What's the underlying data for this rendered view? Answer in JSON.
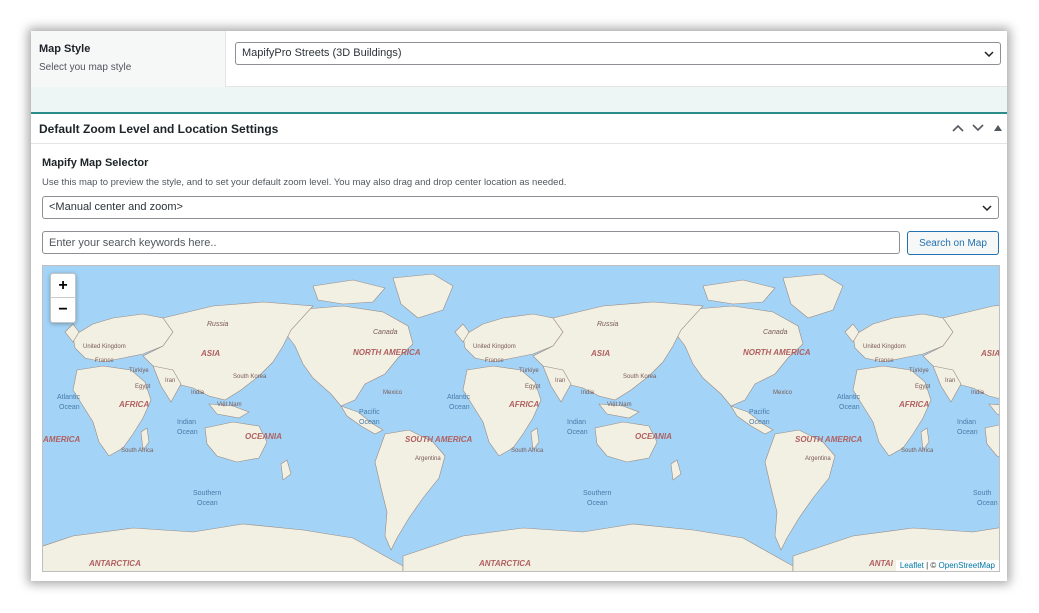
{
  "map_style": {
    "label": "Map Style",
    "description": "Select you map style",
    "selected": "MapifyPro Streets (3D Buildings)"
  },
  "panel": {
    "title": "Default Zoom Level and Location Settings"
  },
  "selector": {
    "title": "Mapify Map Selector",
    "description": "Use this map to preview the style, and to set your default zoom level. You may also drag and drop center location as needed.",
    "selected": "<Manual center and zoom>"
  },
  "search": {
    "placeholder": "Enter your search keywords here..",
    "button_label": "Search on Map"
  },
  "map": {
    "zoom_in_label": "+",
    "zoom_out_label": "−",
    "attribution_leaflet": "Leaflet",
    "attribution_sep": " | © ",
    "attribution_osm": "OpenStreetMap",
    "labels": {
      "russia": "Russia",
      "canada": "Canada",
      "uk": "United Kingdom",
      "france": "France",
      "asia": "ASIA",
      "north_america": "NORTH AMERICA",
      "turkiye": "Türkiye",
      "iran": "Iran",
      "egypt": "Egypt",
      "south_korea": "South Korea",
      "mexico": "Mexico",
      "atlantic": "Atlantic",
      "ocean": "Ocean",
      "africa": "AFRICA",
      "india": "India",
      "viet_nam": "Việt Nam",
      "pacific": "Pacific",
      "indian": "Indian",
      "oceania": "OCEANIA",
      "south_america": "SOUTH AMERICA",
      "america": "AMERICA",
      "south_africa": "South Africa",
      "argentina": "Argentina",
      "southern": "Southern",
      "antarctica": "ANTARCTICA",
      "antai": "ANTAI",
      "south": "South"
    },
    "colors": {
      "water": "#a3d4f7",
      "land": "#f2efe3",
      "border": "#9a8a80",
      "label": "#7a5a56"
    }
  }
}
